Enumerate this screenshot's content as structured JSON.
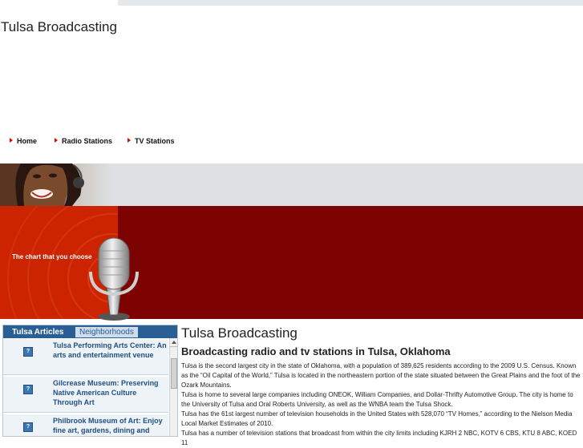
{
  "site": {
    "title": "Tulsa Broadcasting"
  },
  "nav": {
    "items": [
      "Home",
      "Radio Stations",
      "TV Stations"
    ]
  },
  "banner": {
    "tagline": "The chart that you choose"
  },
  "sidebar": {
    "tabs": {
      "active": "Tulsa Articles",
      "inactive": "Neighborhoods"
    },
    "articles": [
      "Tulsa Performing Arts Center: An arts and entertainment venue",
      "Gilcrease Museum: Preserving Native American Culture Through Art",
      "Philbrook Museum of Art: Enjoy fine art, gardens, dining and more"
    ]
  },
  "main": {
    "title": "Tulsa Broadcasting",
    "subtitle": "Broadcasting radio and tv stations in Tulsa, Oklahoma",
    "paragraphs": [
      "Tulsa is the second largest city in the state of Oklahoma, with a population of 389,625 residents according to the 2009 U.S. Census. Known as the “Oil Capital of the World,” Tulsa is located in the northeastern portion of the state situated between the Great Plains and the foot of the Ozark Mountains.",
      "Tulsa is home to several large companies including ONEOK, William Companies, and Dollar-Thrifty Automotive Group. The city is home to the University of Tulsa and Oral Roberts University, as well as the WNBA team the Tulsa Shock.",
      "Tulsa has the 61st largest number of television households in the United States with 528,070 “TV Homes,” according to the Nielson Media Local Market Estimates of 2010.",
      "Tulsa has a number of television stations that broadcast from within the city limits including KJRH 2 NBC, KOTV 6 CBS, KTU 8 ABC, KOED 11"
    ]
  },
  "colors": {
    "accent_red": "#cc2400",
    "banner_dark": "#7d0303",
    "tab_blue": "#2a5f96",
    "link_blue": "#1f4f86"
  }
}
